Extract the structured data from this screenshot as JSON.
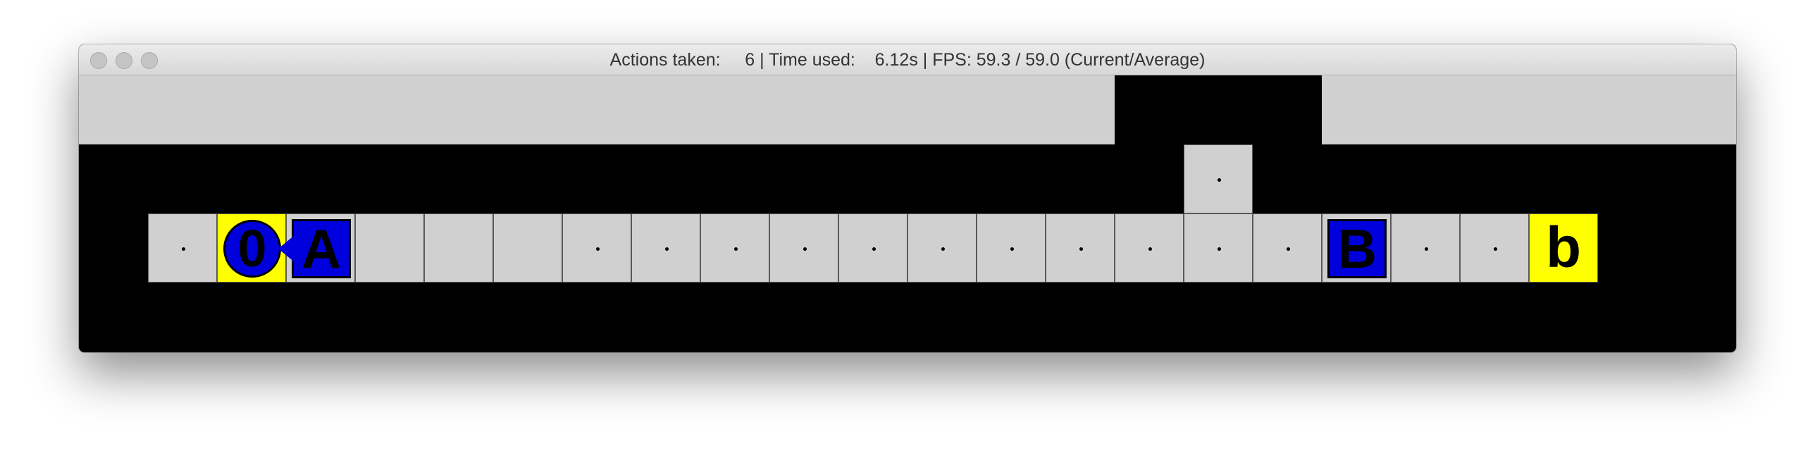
{
  "window": {
    "title": "Actions taken:     6 | Time used:    6.12s | FPS: 59.3 / 59.0 (Current/Average)"
  },
  "game": {
    "agent_label": "0",
    "agent_facing": "left",
    "box_a_label": "A",
    "box_b_label": "B",
    "goal_label": "b",
    "colors": {
      "floor": "#d0d0d0",
      "wall": "#000000",
      "goal": "#ffff00",
      "box": "#0000dd",
      "agent": "#0000dd"
    },
    "row_cells": [
      {
        "col": 0,
        "type": "dot"
      },
      {
        "col": 1,
        "type": "agent-on-goal"
      },
      {
        "col": 2,
        "type": "box-a"
      },
      {
        "col": 3,
        "type": "floor"
      },
      {
        "col": 4,
        "type": "floor"
      },
      {
        "col": 5,
        "type": "floor"
      },
      {
        "col": 6,
        "type": "dot"
      },
      {
        "col": 7,
        "type": "dot"
      },
      {
        "col": 8,
        "type": "dot"
      },
      {
        "col": 9,
        "type": "dot"
      },
      {
        "col": 10,
        "type": "dot"
      },
      {
        "col": 11,
        "type": "dot"
      },
      {
        "col": 12,
        "type": "dot"
      },
      {
        "col": 13,
        "type": "dot"
      },
      {
        "col": 14,
        "type": "dot"
      },
      {
        "col": 15,
        "type": "dot"
      },
      {
        "col": 16,
        "type": "dot"
      },
      {
        "col": 17,
        "type": "box-b"
      },
      {
        "col": 18,
        "type": "dot"
      },
      {
        "col": 19,
        "type": "dot"
      },
      {
        "col": 20,
        "type": "goal-b"
      }
    ],
    "upper_cell": {
      "col": 15,
      "type": "dot"
    }
  }
}
